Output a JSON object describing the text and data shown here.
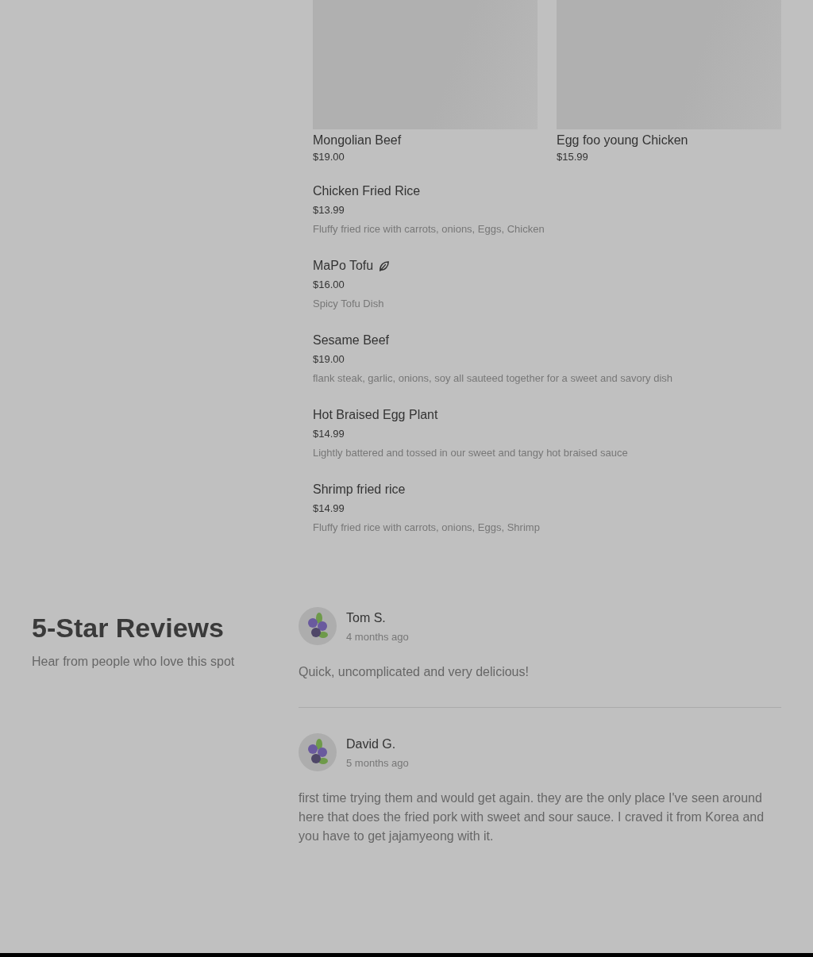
{
  "featured_items": [
    {
      "name": "Mongolian Beef",
      "price": "$19.00"
    },
    {
      "name": "Egg foo young Chicken",
      "price": "$15.99"
    }
  ],
  "menu_items": [
    {
      "name": "Chicken Fried Rice",
      "vegetarian": false,
      "price": "$13.99",
      "description": "Fluffy fried rice with carrots, onions, Eggs, Chicken"
    },
    {
      "name": "MaPo Tofu",
      "vegetarian": true,
      "price": "$16.00",
      "description": "Spicy Tofu Dish"
    },
    {
      "name": "Sesame Beef",
      "vegetarian": false,
      "price": "$19.00",
      "description": "flank steak, garlic, onions, soy all sauteed together for a sweet and savory dish"
    },
    {
      "name": "Hot Braised Egg Plant",
      "vegetarian": false,
      "price": "$14.99",
      "description": "Lightly battered and tossed in our sweet and tangy hot braised sauce"
    },
    {
      "name": "Shrimp fried rice",
      "vegetarian": false,
      "price": "$14.99",
      "description": "Fluffy fried rice with carrots, onions, Eggs, Shrimp"
    }
  ],
  "reviews_section": {
    "title": "5-Star Reviews",
    "subtitle": "Hear from people who love this spot"
  },
  "reviews": [
    {
      "author": "Tom S.",
      "time": "4 months ago",
      "text": "Quick, uncomplicated and very delicious!"
    },
    {
      "author": "David G.",
      "time": "5 months ago",
      "text": "first time trying them and would get again. they are the only place I've seen around here that does the fried pork with sweet and sour sauce. I craved it from Korea and you have to get jajamyeong with it."
    }
  ]
}
